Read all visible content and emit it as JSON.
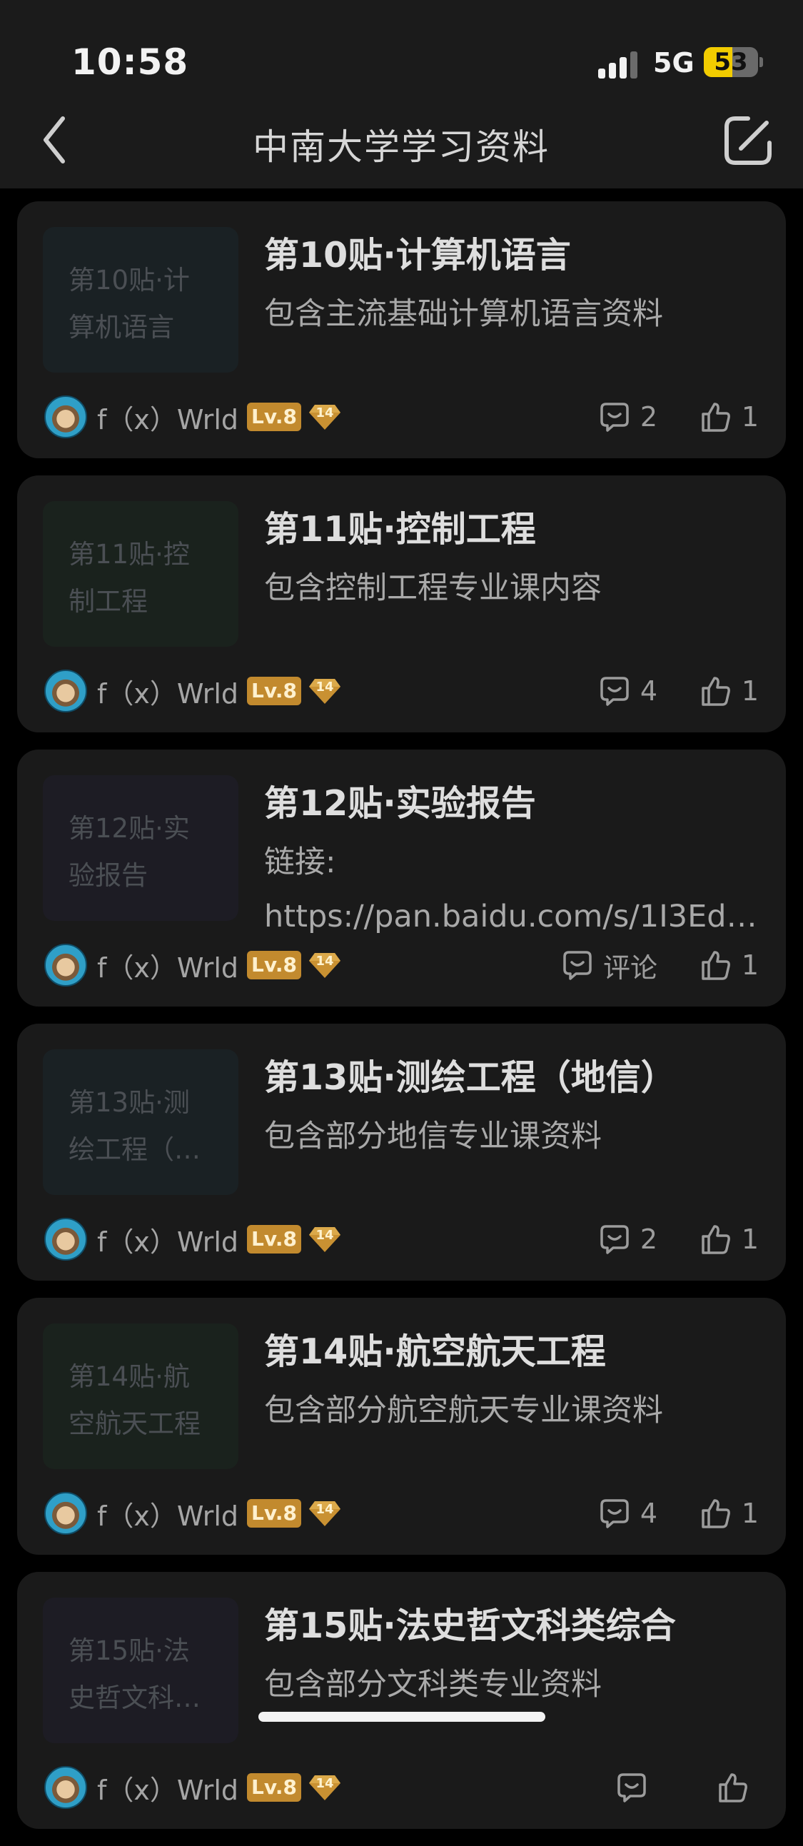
{
  "status_bar": {
    "time": "10:58",
    "network": "5G",
    "battery": "53",
    "battery_level": 0.53
  },
  "header": {
    "title": "中南大学学习资料",
    "back_icon": "chevron-left-icon",
    "compose_icon": "compose-icon"
  },
  "colors": {
    "background": "#000000",
    "card": "#1a1a1a",
    "level_badge": "#c28a2e",
    "gem_badge": "#c99132",
    "battery_fill": "#f2cc00"
  },
  "posts": [
    {
      "thumb_lines": [
        "第10贴·计",
        "算机语言"
      ],
      "thumb_color": "#1a2124",
      "title": "第10贴·计算机语言",
      "desc_lines": [
        "包含主流基础计算机语言资料"
      ],
      "author": "f（x）Wrld",
      "level": "Lv.8",
      "gem": "14",
      "comments": "2",
      "likes": "1"
    },
    {
      "thumb_lines": [
        "第11贴·控",
        "制工程"
      ],
      "thumb_color": "#1a221d",
      "title": "第11贴·控制工程",
      "desc_lines": [
        "包含控制工程专业课内容"
      ],
      "author": "f（x）Wrld",
      "level": "Lv.8",
      "gem": "14",
      "comments": "4",
      "likes": "1"
    },
    {
      "thumb_lines": [
        "第12贴·实",
        "验报告"
      ],
      "thumb_color": "#1d1c24",
      "title": "第12贴·实验报告",
      "desc_lines": [
        "链接:",
        "https://pan.baidu.com/s/1I3EdC…"
      ],
      "author": "f（x）Wrld",
      "level": "Lv.8",
      "gem": "14",
      "comments": "评论",
      "likes": "1"
    },
    {
      "thumb_lines": [
        "第13贴·测",
        "绘工程（…"
      ],
      "thumb_color": "#1a2124",
      "title": "第13贴·测绘工程（地信）",
      "desc_lines": [
        "包含部分地信专业课资料"
      ],
      "author": "f（x）Wrld",
      "level": "Lv.8",
      "gem": "14",
      "comments": "2",
      "likes": "1"
    },
    {
      "thumb_lines": [
        "第14贴·航",
        "空航天工程"
      ],
      "thumb_color": "#1a221d",
      "title": "第14贴·航空航天工程",
      "desc_lines": [
        "包含部分航空航天专业课资料"
      ],
      "author": "f（x）Wrld",
      "level": "Lv.8",
      "gem": "14",
      "comments": "4",
      "likes": "1"
    },
    {
      "thumb_lines": [
        "第15贴·法",
        "史哲文科…"
      ],
      "thumb_color": "#1d1c24",
      "title": "第15贴·法史哲文科类综合",
      "desc_lines": [
        "包含部分文科类专业资料"
      ],
      "author": "f（x）Wrld",
      "level": "Lv.8",
      "gem": "14",
      "comments": "",
      "likes": ""
    }
  ]
}
